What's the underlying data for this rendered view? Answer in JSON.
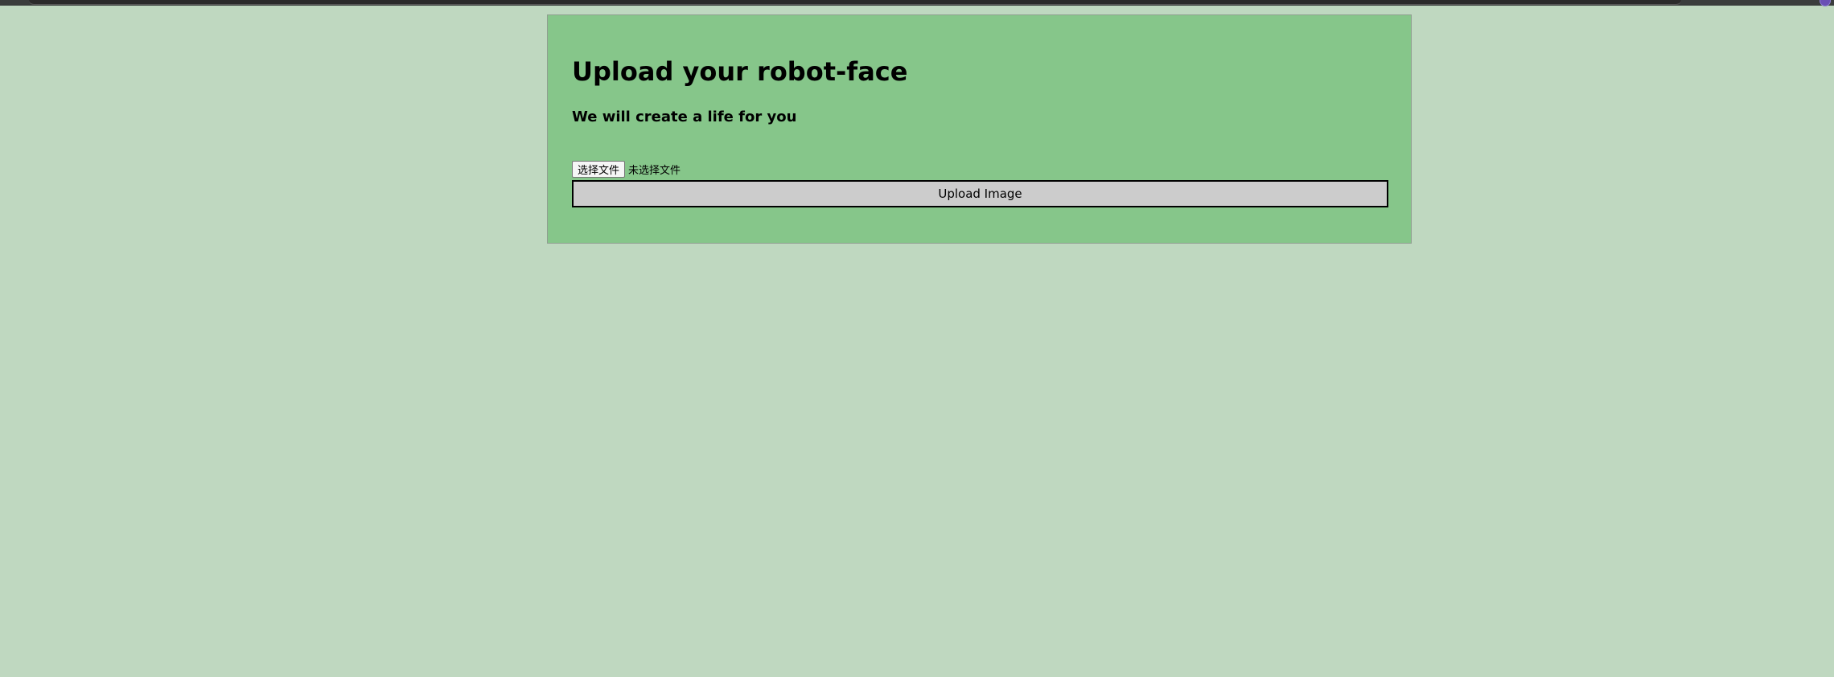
{
  "page": {
    "title": "Upload your robot-face",
    "subtitle": "We will create a life for you"
  },
  "file_input": {
    "choose_label": "选择文件",
    "status": "未选择文件"
  },
  "upload_button": {
    "label": "Upload Image"
  },
  "colors": {
    "background": "#bfd8c0",
    "card": "#86c68a",
    "button": "#cccccc"
  }
}
